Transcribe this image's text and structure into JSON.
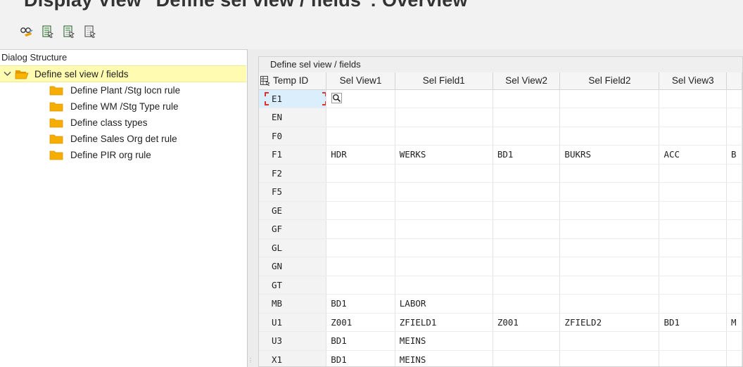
{
  "window": {
    "title": "Display View \"Define sel view / fields\": Overview"
  },
  "toolbar": {
    "icons": [
      "glasses-icon",
      "select-all-icon",
      "select-block-icon",
      "deselect-all-icon"
    ]
  },
  "dialog_structure": {
    "header": "Dialog Structure",
    "root": {
      "label": "Define sel view / fields",
      "icon": "folder-open-icon",
      "selected": true
    },
    "children": [
      {
        "label": "Define Plant /Stg locn rule",
        "icon": "folder-icon"
      },
      {
        "label": "Define WM /Stg Type rule",
        "icon": "folder-icon"
      },
      {
        "label": "Define class types",
        "icon": "folder-icon"
      },
      {
        "label": "Define Sales Org det rule",
        "icon": "folder-icon"
      },
      {
        "label": "Define PIR org rule",
        "icon": "folder-icon"
      }
    ]
  },
  "table": {
    "caption": "Define sel view / fields",
    "columns": [
      "Temp ID",
      "Sel View1",
      "Sel Field1",
      "Sel View2",
      "Sel Field2",
      "Sel View3",
      ""
    ],
    "rows": [
      [
        "E1",
        "",
        "",
        "",
        "",
        "",
        ""
      ],
      [
        "EN",
        "",
        "",
        "",
        "",
        "",
        ""
      ],
      [
        "F0",
        "",
        "",
        "",
        "",
        "",
        ""
      ],
      [
        "F1",
        "HDR",
        "WERKS",
        "BD1",
        "BUKRS",
        "ACC",
        "B"
      ],
      [
        "F2",
        "",
        "",
        "",
        "",
        "",
        ""
      ],
      [
        "F5",
        "",
        "",
        "",
        "",
        "",
        ""
      ],
      [
        "GE",
        "",
        "",
        "",
        "",
        "",
        ""
      ],
      [
        "GF",
        "",
        "",
        "",
        "",
        "",
        ""
      ],
      [
        "GL",
        "",
        "",
        "",
        "",
        "",
        ""
      ],
      [
        "GN",
        "",
        "",
        "",
        "",
        "",
        ""
      ],
      [
        "GT",
        "",
        "",
        "",
        "",
        "",
        ""
      ],
      [
        "MB",
        "BD1",
        "LABOR",
        "",
        "",
        "",
        ""
      ],
      [
        "U1",
        "Z001",
        "ZFIELD1",
        "Z001",
        "ZFIELD2",
        "BD1",
        "M"
      ],
      [
        "U3",
        "BD1",
        "MEINS",
        "",
        "",
        "",
        ""
      ],
      [
        "X1",
        "BD1",
        "MEINS",
        "",
        "",
        "",
        ""
      ]
    ],
    "focused_cell": {
      "row": 0,
      "column": "Temp ID",
      "value_help_icon": "magnifier-icon"
    }
  },
  "colors": {
    "selected_node_bg": "#fffbb0",
    "folder": "#f0a800",
    "focus_cell_bg": "#dbeefc",
    "focus_marker": "#e03030"
  }
}
